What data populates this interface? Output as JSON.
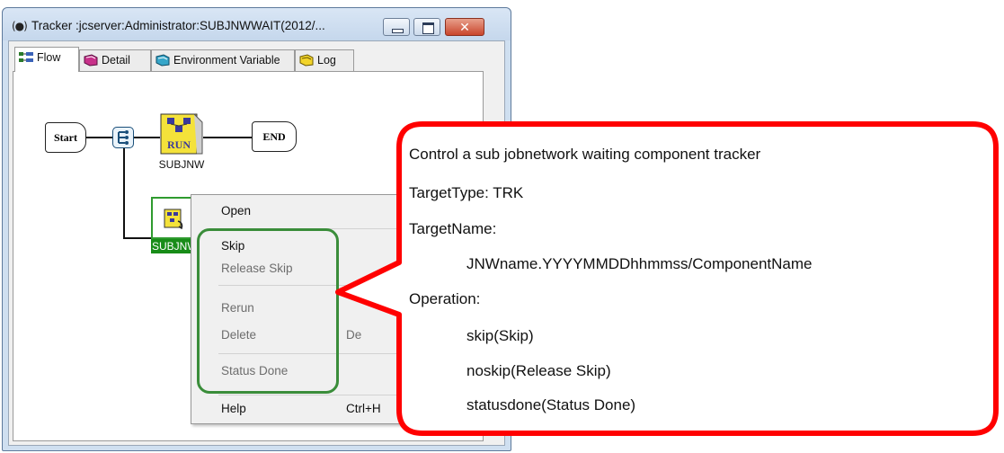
{
  "window": {
    "title": "Tracker :jcserver:Administrator:SUBJNWWAIT(2012/...",
    "close_glyph": "✕"
  },
  "tabs": [
    {
      "label": "Flow",
      "icon": "flow-icon",
      "active": true
    },
    {
      "label": "Detail",
      "icon": "detail-icon",
      "active": false
    },
    {
      "label": "Environment Variable",
      "icon": "environment-icon",
      "active": false
    },
    {
      "label": "Log",
      "icon": "log-icon",
      "active": false
    }
  ],
  "flow": {
    "start_label": "Start",
    "end_label": "END",
    "jobnetwork_label": "SUBJNW",
    "run_badge": "RUN",
    "waiting_label": "SUBJNW"
  },
  "context_menu": {
    "items": [
      {
        "label": "Open",
        "shortcut": "",
        "enabled": true
      },
      {
        "label": "Skip",
        "shortcut": "",
        "enabled": true
      },
      {
        "label": "Release Skip",
        "shortcut": "",
        "enabled": false
      },
      {
        "label": "Rerun",
        "shortcut": "",
        "enabled": false
      },
      {
        "label": "Delete",
        "shortcut": "De",
        "enabled": false
      },
      {
        "label": "Status Done",
        "shortcut": "",
        "enabled": false
      },
      {
        "label": "Help",
        "shortcut": "Ctrl+H",
        "enabled": true
      }
    ]
  },
  "callout": {
    "lines": [
      "Control a sub jobnetwork waiting component tracker",
      "TargetType: TRK",
      "TargetName:",
      "JNWname.YYYYMMDDhhmmss/ComponentName",
      "Operation:",
      "skip(Skip)",
      "noskip(Release Skip)",
      "statusdone(Status Done)"
    ]
  },
  "colors": {
    "callout_border": "#ff0000",
    "highlight_outline": "#3a8d3a",
    "selection_green": "#188c18"
  }
}
